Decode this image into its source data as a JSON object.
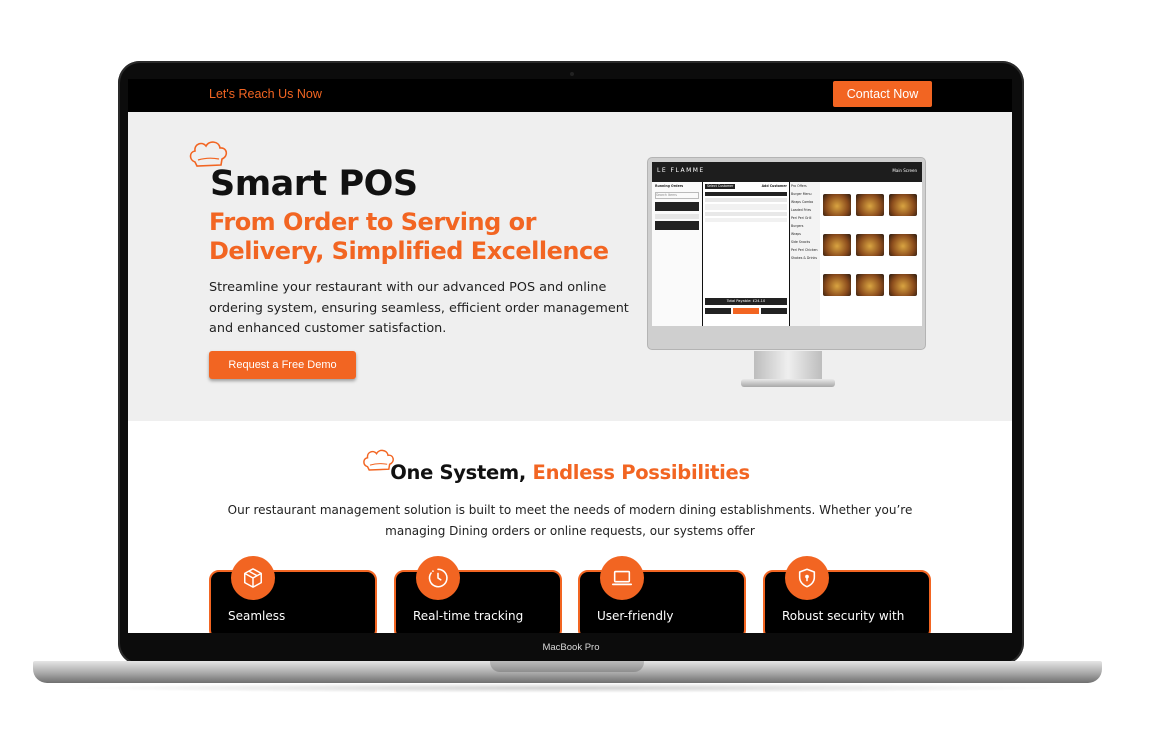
{
  "device": {
    "label": "MacBook Pro"
  },
  "topbar": {
    "reach_text": "Let's Reach Us Now",
    "contact_label": "Contact Now"
  },
  "hero": {
    "title": "Smart POS",
    "subtitle": "From Order to Serving or Delivery, Simplified Excellence",
    "description": "Streamline your restaurant with our advanced POS and online ordering system, ensuring seamless, efficient order management and enhanced customer satisfaction.",
    "cta_label": "Request a Free Demo"
  },
  "pos_preview": {
    "logo": "LE FLAMME",
    "top_right": "Main Screen",
    "left_title": "Running Orders",
    "search_placeholder": "Search Items",
    "add_customer": "Add Customer",
    "select_customer": "Select Customer",
    "total_payable": "Total Payable: £24.10",
    "categories": [
      "Pro Offers",
      "Burger Menu",
      "Wraps Combo",
      "Loaded Fries",
      "Peri Peri Grill",
      "Burgers",
      "Wraps",
      "Side Snacks",
      "Peri Peri Chicken",
      "Shakes & Drinks"
    ]
  },
  "section2": {
    "title_dark": "One System,",
    "title_accent": "Endless Possibilities",
    "description": "Our restaurant management solution is built to meet the needs of modern dining establishments. Whether you’re managing Dining orders or online requests, our systems offer"
  },
  "features": [
    {
      "label": "Seamless",
      "icon": "box-icon"
    },
    {
      "label": "Real-time tracking",
      "icon": "clock-icon"
    },
    {
      "label": "User-friendly",
      "icon": "laptop-icon"
    },
    {
      "label": "Robust security with",
      "icon": "shield-lock-icon"
    }
  ],
  "colors": {
    "accent": "#f26522",
    "dark": "#000000",
    "hero_bg": "#efefef"
  }
}
